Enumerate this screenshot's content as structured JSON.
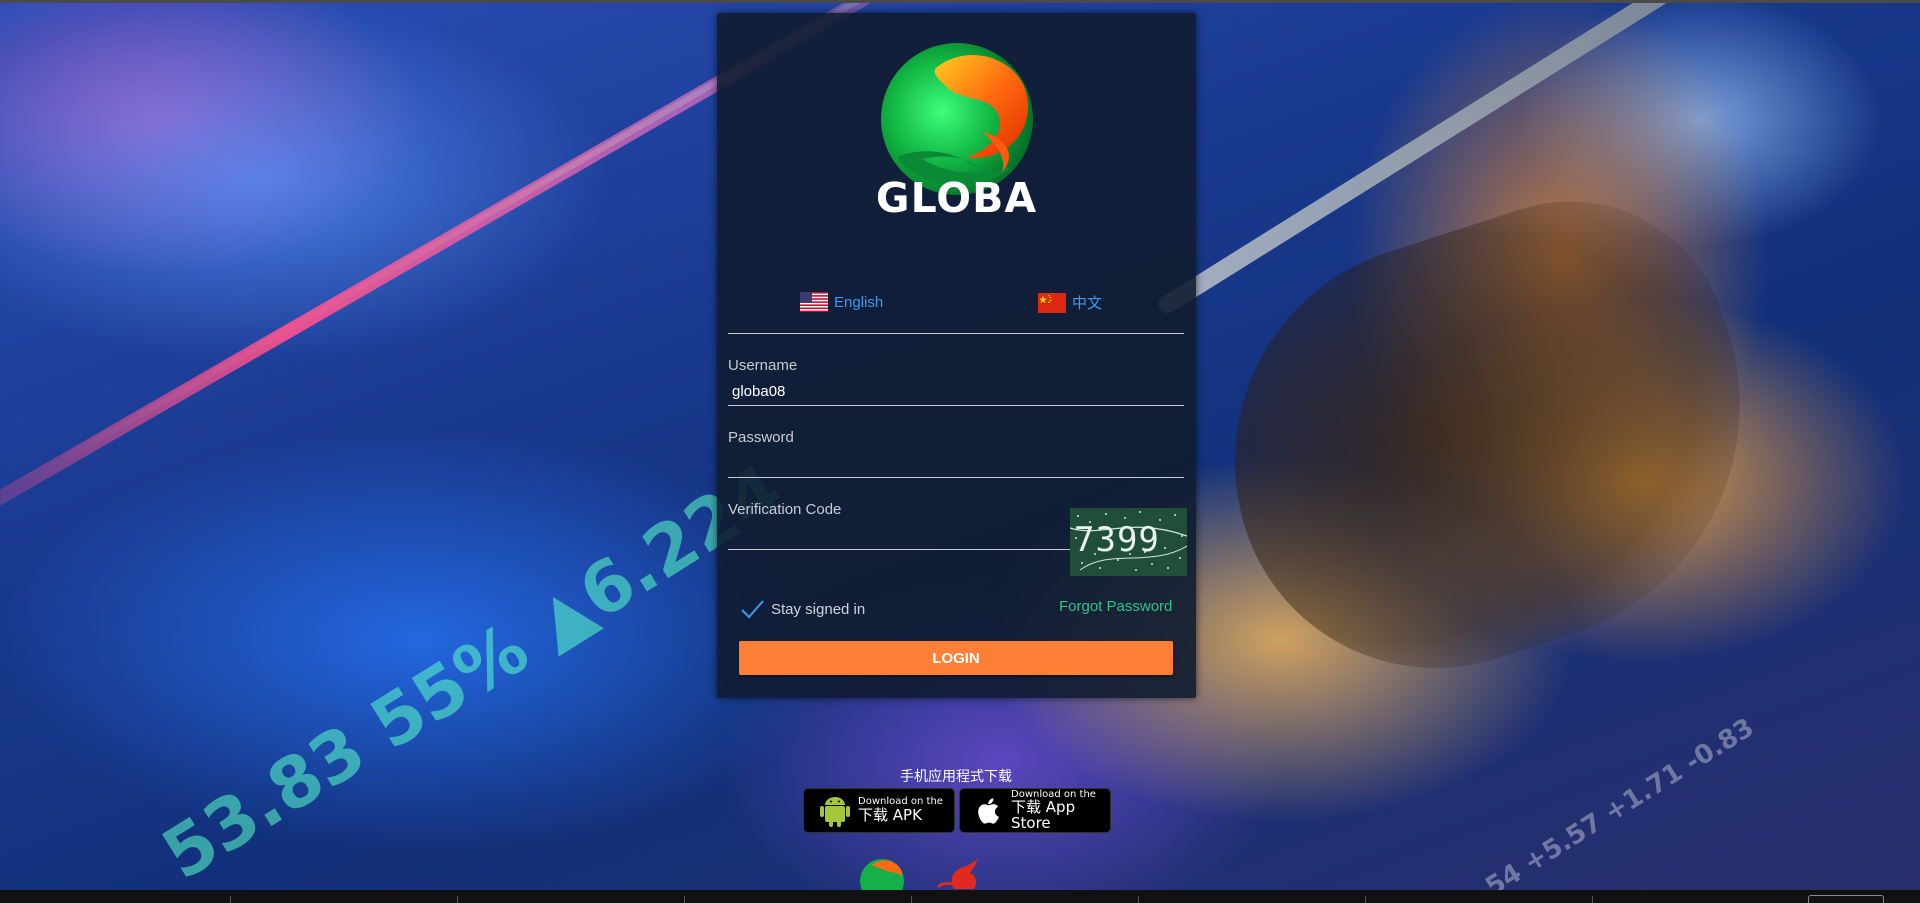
{
  "panel": {
    "brand": "GLOBA"
  },
  "languages": [
    {
      "label": "English",
      "flag": "us-flag-icon"
    },
    {
      "label": "中文",
      "flag": "cn-flag-icon"
    }
  ],
  "form": {
    "username_label": "Username",
    "username_value": "globa08",
    "password_label": "Password",
    "password_value": "",
    "code_label": "Verification Code",
    "code_value": "",
    "captcha_text": "7399",
    "stay_signed_in_label": "Stay signed in",
    "stay_signed_in_checked": true,
    "forgot_password_label": "Forgot Password",
    "login_label": "LOGIN"
  },
  "download": {
    "title": "手机应用程式下载",
    "apk": {
      "small": "Download on the",
      "big": "下载 APK"
    },
    "ios": {
      "small": "Download on the",
      "big": "下载 App Store"
    }
  },
  "colors": {
    "accent": "#ff7f36",
    "link_blue": "#3b9bf0",
    "link_green": "#2ec48a",
    "panel_bg": "#101c30"
  }
}
